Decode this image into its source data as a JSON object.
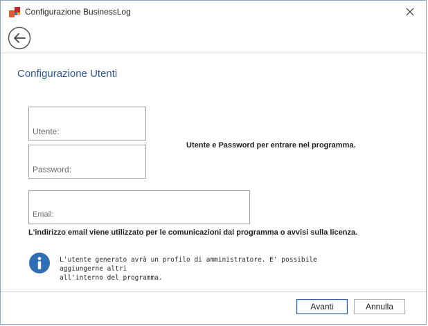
{
  "window": {
    "title": "Configurazione BusinessLog",
    "icons": {
      "app": "businesslog-app-icon",
      "close": "close-icon",
      "back": "back-arrow-icon",
      "info": "info-icon"
    }
  },
  "main": {
    "section_title": "Configurazione Utenti",
    "fields": {
      "user_placeholder": "Utente:",
      "password_placeholder": "Password:",
      "email_placeholder": "Email:"
    },
    "hint_credentials": "Utente e Password per entrare nel programma.",
    "hint_email": "L'indirizzo email viene utilizzato per le comunicazioni dal programma o avvisi sulla licenza.",
    "info_line1": "L'utente generato avrà un profilo di amministratore. E' possibile aggiungerne altri",
    "info_line2": "all'interno del programma."
  },
  "footer": {
    "next_label": "Avanti",
    "cancel_label": "Annulla"
  },
  "colors": {
    "accent": "#2b579a",
    "info_icon": "#2f6db5",
    "logo_orange": "#e8592a",
    "logo_red": "#c1272d",
    "logo_blue": "#2f7ec1",
    "logo_yellow": "#f5b323"
  }
}
